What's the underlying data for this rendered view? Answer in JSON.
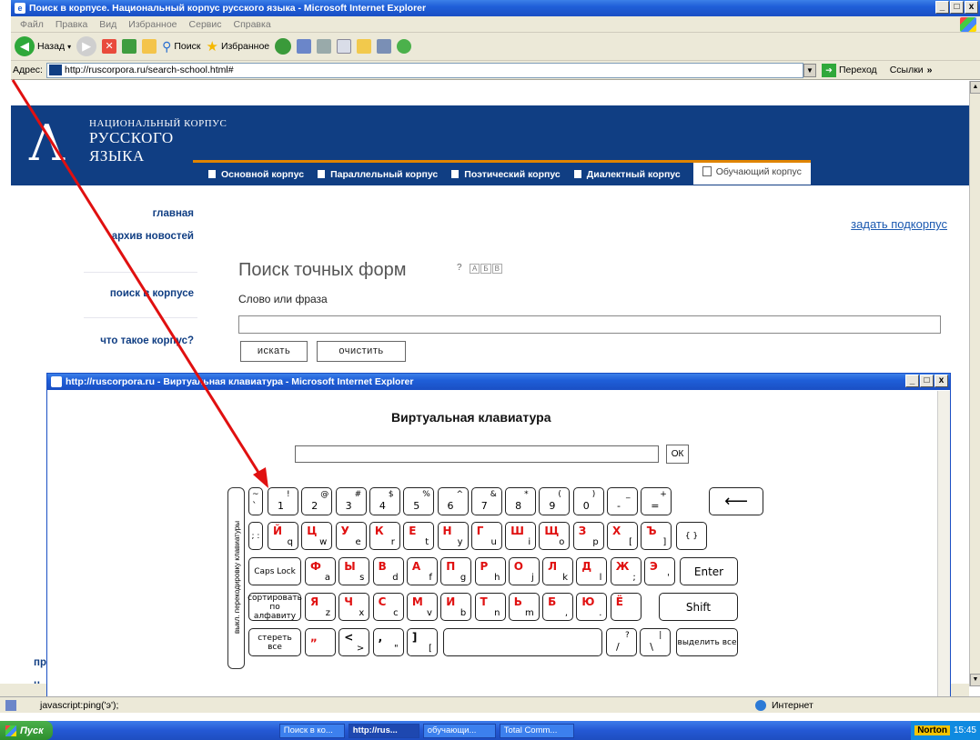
{
  "window": {
    "title": "Поиск в корпусе. Национальный корпус русского языка - Microsoft Internet Explorer",
    "min": "_",
    "max": "□",
    "close": "x"
  },
  "menu": {
    "items": [
      "Файл",
      "Правка",
      "Вид",
      "Избранное",
      "Сервис",
      "Справка"
    ]
  },
  "toolbar": {
    "back": "Назад",
    "search": "Поиск",
    "favorites": "Избранное"
  },
  "address": {
    "label": "Адрес:",
    "url": "http://ruscorpora.ru/search-school.html#",
    "go": "Переход",
    "links": "Ссылки"
  },
  "site": {
    "line1": "НАЦИОНАЛЬНЫЙ КОРПУС",
    "line2": "РУССКОГО",
    "line3": "ЯЗЫКА"
  },
  "tabs": [
    "Основной корпус",
    "Параллельный корпус",
    "Поэтический корпус",
    "Диалектный корпус",
    "Обучающий корпус"
  ],
  "nav": {
    "home": "главная",
    "archive": "архив новостей",
    "search": "поиск в корпусе",
    "what": "что такое корпус?",
    "p1": "пр",
    "p2": "н"
  },
  "main": {
    "subcorpus": "задать подкорпус",
    "form_title": "Поиск точных форм",
    "help": "?",
    "abv": [
      "А",
      "Б",
      "В"
    ],
    "label": "Слово или фраза",
    "search_btn": "искать",
    "clear_btn": "очистить"
  },
  "popup": {
    "title": "http://ruscorpora.ru - Виртуальная клавиатура - Microsoft Internet Explorer",
    "kb_title": "Виртуальная клавиатура",
    "ok": "ОК",
    "toggle": "выкл. перекодировку клавиатуры"
  },
  "keys": {
    "row1": [
      [
        "`",
        "~"
      ],
      [
        "1",
        "!"
      ],
      [
        "2",
        "@"
      ],
      [
        "3",
        "#"
      ],
      [
        "4",
        "$"
      ],
      [
        "5",
        "%"
      ],
      [
        "6",
        "^"
      ],
      [
        "7",
        "&"
      ],
      [
        "8",
        "*"
      ],
      [
        "9",
        "("
      ],
      [
        "0",
        ")"
      ],
      [
        "-",
        "_"
      ],
      [
        "=",
        "+"
      ]
    ],
    "backspace": "⟵",
    "row2": [
      [
        "Й",
        "q"
      ],
      [
        "Ц",
        "w"
      ],
      [
        "У",
        "e"
      ],
      [
        "К",
        "r"
      ],
      [
        "Е",
        "t"
      ],
      [
        "Н",
        "y"
      ],
      [
        "Г",
        "u"
      ],
      [
        "Ш",
        "i"
      ],
      [
        "Щ",
        "o"
      ],
      [
        "З",
        "p"
      ],
      [
        "Х",
        "["
      ],
      [
        "Ъ",
        "]"
      ]
    ],
    "row2_first": ";  :",
    "row2_last": "{ }",
    "caps": "Caps Lock",
    "row3": [
      [
        "Ф",
        "a"
      ],
      [
        "Ы",
        "s"
      ],
      [
        "В",
        "d"
      ],
      [
        "А",
        "f"
      ],
      [
        "П",
        "g"
      ],
      [
        "Р",
        "h"
      ],
      [
        "О",
        "j"
      ],
      [
        "Л",
        "k"
      ],
      [
        "Д",
        "l"
      ],
      [
        "Ж",
        ";"
      ],
      [
        "Э",
        "'"
      ]
    ],
    "enter": "Enter",
    "sort": "сортировать по алфавиту",
    "row4": [
      [
        "Я",
        "z"
      ],
      [
        "Ч",
        "x"
      ],
      [
        "С",
        "c"
      ],
      [
        "М",
        "v"
      ],
      [
        "И",
        "b"
      ],
      [
        "Т",
        "n"
      ],
      [
        "Ь",
        "m"
      ],
      [
        "Б",
        ","
      ],
      [
        "Ю",
        "."
      ],
      [
        "Ё",
        ""
      ]
    ],
    "shift": "Shift",
    "erase": "стереть все",
    "row5a": [
      [
        "„",
        ""
      ],
      [
        "<",
        ">"
      ],
      [
        ",",
        "\""
      ],
      [
        "]",
        "["
      ]
    ],
    "row5b": [
      [
        "/",
        "?"
      ],
      [
        "\\",
        "|"
      ]
    ],
    "select_all": "выделить все"
  },
  "status": {
    "text": "javascript:ping('э');",
    "zone": "Интернет"
  },
  "taskbar": {
    "start": "Пуск",
    "tasks": [
      "Поиск в ко...",
      "http://rus...",
      "обучающи...",
      "Total Comm..."
    ],
    "norton": "Norton",
    "time": "15:45"
  },
  "colors": {
    "header": "#103e83",
    "accent": "#e08400",
    "arrow": "#e01010",
    "cyrillic": "#e01010"
  }
}
